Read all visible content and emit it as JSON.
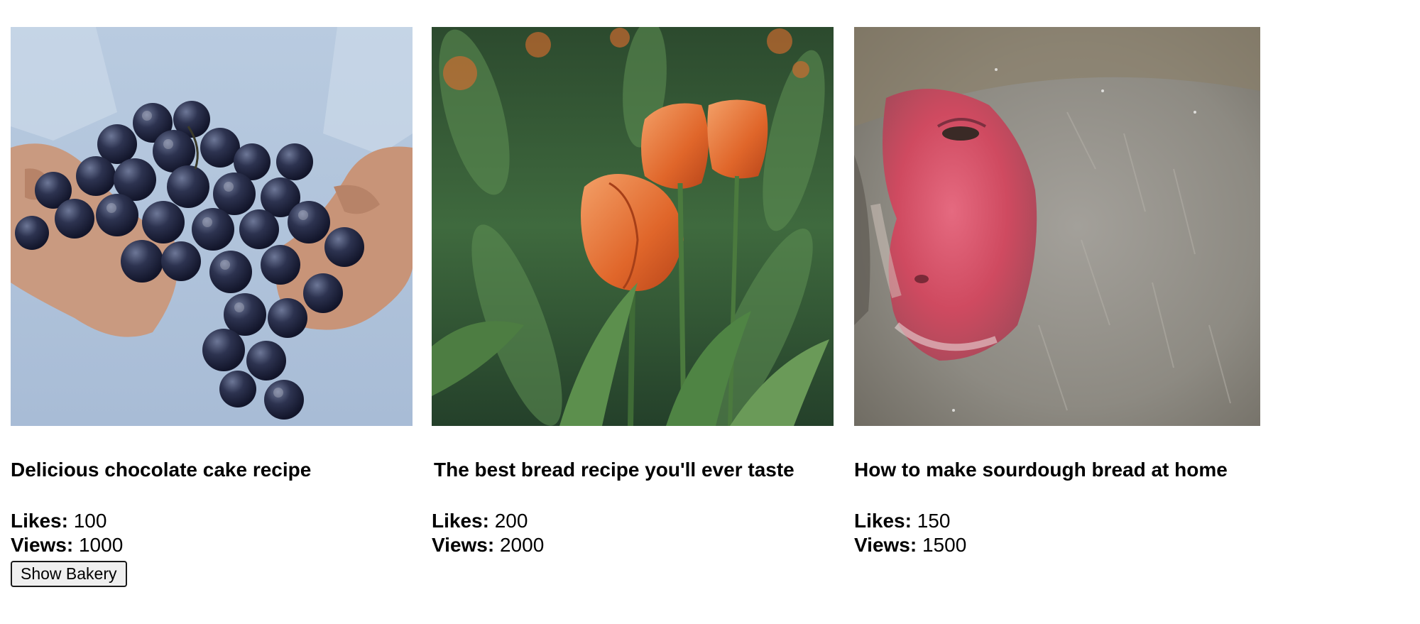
{
  "posts": [
    {
      "title": "Delicious chocolate cake recipe",
      "likes_label": "Likes:",
      "likes": "100",
      "views_label": "Views:",
      "views": "1000",
      "button_label": "Show Bakery",
      "image": "grapes-in-hands"
    },
    {
      "title": "The best bread recipe you'll ever taste",
      "likes_label": "Likes:",
      "likes": "200",
      "views_label": "Views:",
      "views": "2000",
      "image": "orange-tulips"
    },
    {
      "title": "How to make sourdough bread at home",
      "likes_label": "Likes:",
      "likes": "150",
      "views_label": "Views:",
      "views": "1500",
      "image": "snow-monkey"
    }
  ]
}
